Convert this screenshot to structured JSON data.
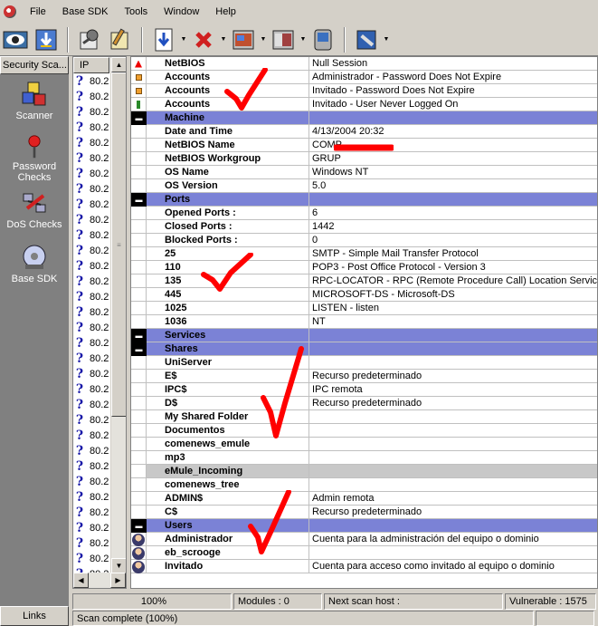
{
  "menu": [
    "File",
    "Base SDK",
    "Tools",
    "Window",
    "Help"
  ],
  "left_panel": {
    "header": "Security Sca...",
    "items": [
      {
        "label": "Scanner",
        "icon": "scanner-cubes-icon"
      },
      {
        "label": "Password Checks",
        "icon": "pin-icon"
      },
      {
        "label": "DoS Checks",
        "icon": "dos-network-icon"
      },
      {
        "label": "Base SDK",
        "icon": "cd-icon"
      }
    ],
    "bottom": "Links"
  },
  "ip_list": {
    "header": "IP",
    "row_text": "80.2",
    "row_count": 33
  },
  "results": [
    {
      "type": "item",
      "icon": "red-arrow",
      "name": "NetBIOS",
      "value": "Null Session"
    },
    {
      "type": "item",
      "icon": "orange",
      "name": "Accounts",
      "value": "Administrador - Password Does Not Expire"
    },
    {
      "type": "item",
      "icon": "orange",
      "name": "Accounts",
      "value": "Invitado - Password Does Not Expire"
    },
    {
      "type": "item",
      "icon": "green",
      "name": "Accounts",
      "value": "Invitado - User Never Logged On"
    },
    {
      "type": "section",
      "name": "Machine",
      "value": ""
    },
    {
      "type": "item",
      "icon": "",
      "name": "Date and Time",
      "value": "4/13/2004 20:32"
    },
    {
      "type": "item",
      "icon": "",
      "name": "NetBIOS Name",
      "value": "COMP"
    },
    {
      "type": "item",
      "icon": "",
      "name": "NetBIOS Workgroup",
      "value": "GRUP"
    },
    {
      "type": "item",
      "icon": "",
      "name": "OS Name",
      "value": "Windows NT"
    },
    {
      "type": "item",
      "icon": "",
      "name": "OS Version",
      "value": "5.0"
    },
    {
      "type": "section",
      "name": "Ports",
      "value": ""
    },
    {
      "type": "item",
      "icon": "",
      "name": "Opened Ports :",
      "value": "6"
    },
    {
      "type": "item",
      "icon": "",
      "name": "Closed Ports :",
      "value": "1442"
    },
    {
      "type": "item",
      "icon": "",
      "name": "Blocked Ports :",
      "value": "0"
    },
    {
      "type": "item",
      "icon": "",
      "name": "25",
      "value": "SMTP - Simple Mail Transfer Protocol"
    },
    {
      "type": "item",
      "icon": "",
      "name": "110",
      "value": "POP3 - Post Office Protocol - Version 3"
    },
    {
      "type": "item",
      "icon": "",
      "name": "135",
      "value": "RPC-LOCATOR - RPC (Remote Procedure Call) Location Service"
    },
    {
      "type": "item",
      "icon": "",
      "name": "445",
      "value": "MICROSOFT-DS - Microsoft-DS"
    },
    {
      "type": "item",
      "icon": "",
      "name": "1025",
      "value": "LISTEN - listen"
    },
    {
      "type": "item",
      "icon": "",
      "name": "1036",
      "value": "NT"
    },
    {
      "type": "section",
      "name": "Services",
      "value": ""
    },
    {
      "type": "section",
      "name": "Shares",
      "value": ""
    },
    {
      "type": "item",
      "icon": "",
      "name": "UniServer",
      "value": ""
    },
    {
      "type": "item",
      "icon": "",
      "name": "E$",
      "value": "Recurso predeterminado"
    },
    {
      "type": "item",
      "icon": "",
      "name": "IPC$",
      "value": "IPC remota"
    },
    {
      "type": "item",
      "icon": "",
      "name": "D$",
      "value": "Recurso predeterminado"
    },
    {
      "type": "item",
      "icon": "",
      "name": "My Shared Folder",
      "value": ""
    },
    {
      "type": "item",
      "icon": "",
      "name": "Documentos",
      "value": ""
    },
    {
      "type": "item",
      "icon": "",
      "name": "comenews_emule",
      "value": ""
    },
    {
      "type": "item",
      "icon": "",
      "name": "mp3",
      "value": ""
    },
    {
      "type": "gray",
      "icon": "",
      "name": "eMule_Incoming",
      "value": ""
    },
    {
      "type": "item",
      "icon": "",
      "name": "comenews_tree",
      "value": ""
    },
    {
      "type": "item",
      "icon": "",
      "name": "ADMIN$",
      "value": "Admin remota"
    },
    {
      "type": "item",
      "icon": "",
      "name": "C$",
      "value": "Recurso predeterminado"
    },
    {
      "type": "section",
      "name": "Users",
      "value": ""
    },
    {
      "type": "item",
      "icon": "user",
      "name": "Administrador",
      "value": "Cuenta para la administración del equipo o dominio"
    },
    {
      "type": "item",
      "icon": "user",
      "name": "eb_scrooge",
      "value": ""
    },
    {
      "type": "item",
      "icon": "user",
      "name": "Invitado",
      "value": "Cuenta para acceso como invitado al equipo o dominio"
    }
  ],
  "status": {
    "progress": "100%",
    "progress_fraction": 1.0,
    "modules": "Modules : 0",
    "next_scan": "Next scan host :",
    "vulnerable": "Vulnerable : 1575",
    "message": "Scan complete (100%)"
  },
  "colors": {
    "section": "#7b82d6",
    "check": "#ff0000"
  }
}
